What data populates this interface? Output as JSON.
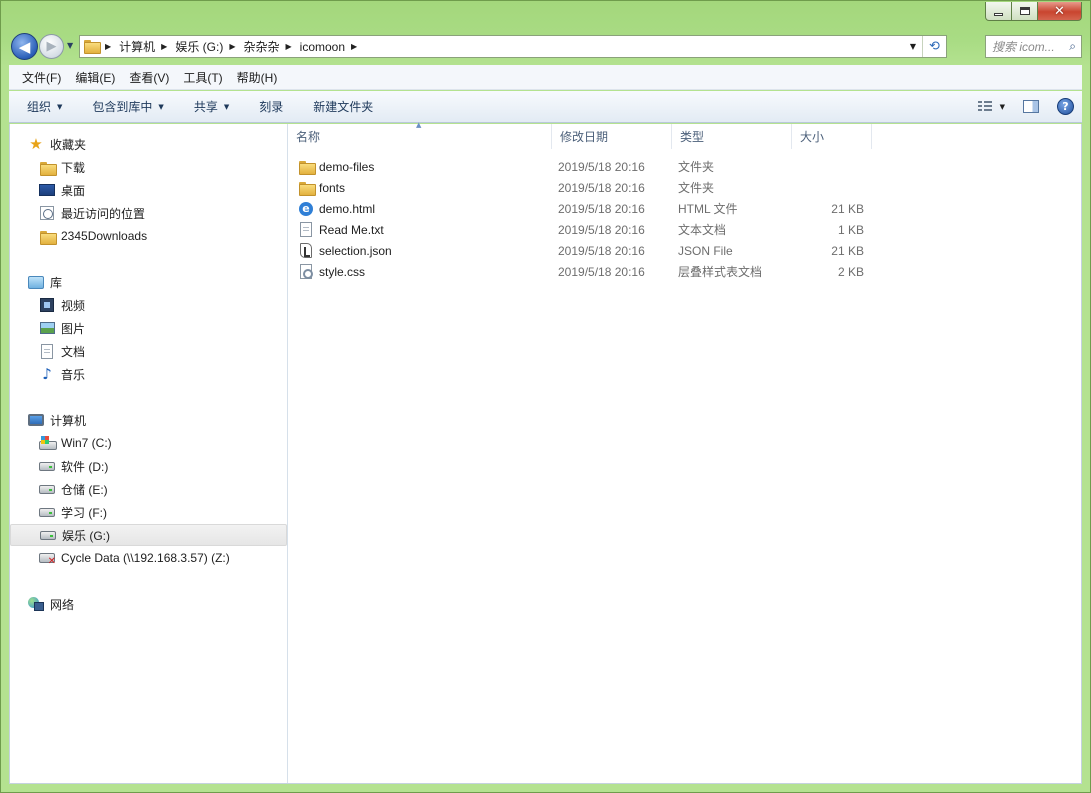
{
  "window": {
    "caption": {
      "minimize": "–",
      "maximize": "□",
      "close": "✕"
    }
  },
  "nav": {
    "back_glyph": "◀",
    "forward_glyph": "▶",
    "breadcrumb": [
      "计算机",
      "娱乐 (G:)",
      "杂杂杂",
      "icomoon"
    ],
    "search_placeholder": "搜索 icom...",
    "search_icon": "magnifier-icon",
    "refresh_icon": "refresh-icon"
  },
  "menubar": {
    "items": [
      "文件(F)",
      "编辑(E)",
      "查看(V)",
      "工具(T)",
      "帮助(H)"
    ]
  },
  "commandbar": {
    "organize": "组织",
    "include_in_library": "包含到库中",
    "share": "共享",
    "burn": "刻录",
    "new_folder": "新建文件夹",
    "help_glyph": "?"
  },
  "navpane": {
    "favorites": {
      "label": "收藏夹",
      "icon": "star-icon"
    },
    "favorites_items": [
      {
        "label": "下载",
        "icon": "folder-icon"
      },
      {
        "label": "桌面",
        "icon": "desktop-icon"
      },
      {
        "label": "最近访问的位置",
        "icon": "recent-places-icon"
      },
      {
        "label": "2345Downloads",
        "icon": "folder-icon"
      }
    ],
    "libraries": {
      "label": "库",
      "icon": "library-icon"
    },
    "libraries_items": [
      {
        "label": "视频",
        "icon": "video-icon"
      },
      {
        "label": "图片",
        "icon": "pictures-icon"
      },
      {
        "label": "文档",
        "icon": "documents-icon"
      },
      {
        "label": "音乐",
        "icon": "music-icon"
      }
    ],
    "computer": {
      "label": "计算机",
      "icon": "computer-icon"
    },
    "computer_items": [
      {
        "label": "Win7 (C:)",
        "icon": "windows-drive-icon"
      },
      {
        "label": "软件 (D:)",
        "icon": "drive-icon"
      },
      {
        "label": "仓储 (E:)",
        "icon": "drive-icon"
      },
      {
        "label": "学习 (F:)",
        "icon": "drive-icon"
      },
      {
        "label": "娱乐 (G:)",
        "icon": "drive-icon",
        "selected": true
      },
      {
        "label": "Cycle Data (\\\\192.168.3.57) (Z:)",
        "icon": "network-drive-icon"
      }
    ],
    "network": {
      "label": "网络",
      "icon": "network-icon"
    }
  },
  "filelist": {
    "columns": [
      "名称",
      "修改日期",
      "类型",
      "大小"
    ],
    "sort_glyph": "▲",
    "rows": [
      {
        "name": "demo-files",
        "date": "2019/5/18 20:16",
        "type": "文件夹",
        "size": "",
        "icon": "folder-icon"
      },
      {
        "name": "fonts",
        "date": "2019/5/18 20:16",
        "type": "文件夹",
        "size": "",
        "icon": "folder-icon"
      },
      {
        "name": "demo.html",
        "date": "2019/5/18 20:16",
        "type": "HTML 文件",
        "size": "21 KB",
        "icon": "ie-html-icon"
      },
      {
        "name": "Read Me.txt",
        "date": "2019/5/18 20:16",
        "type": "文本文档",
        "size": "1 KB",
        "icon": "text-file-icon"
      },
      {
        "name": "selection.json",
        "date": "2019/5/18 20:16",
        "type": "JSON File",
        "size": "21 KB",
        "icon": "json-file-icon"
      },
      {
        "name": "style.css",
        "date": "2019/5/18 20:16",
        "type": "层叠样式表文档",
        "size": "2 KB",
        "icon": "css-file-icon"
      }
    ]
  }
}
